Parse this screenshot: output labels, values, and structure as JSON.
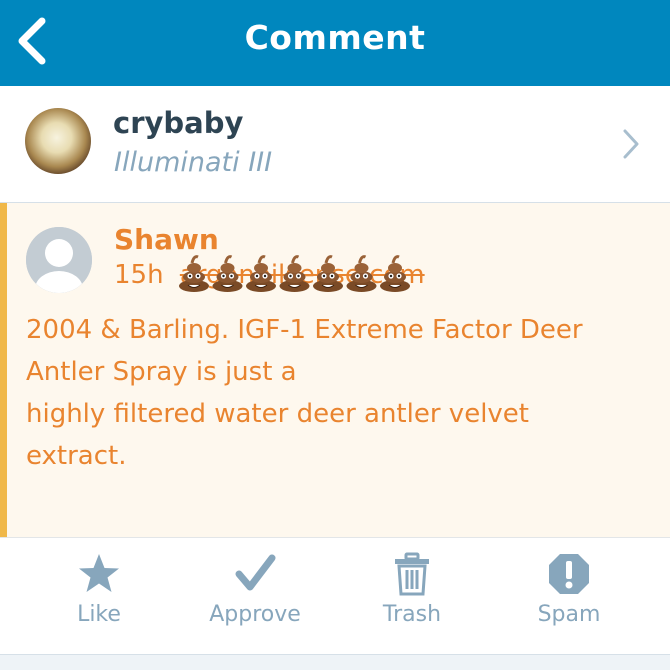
{
  "header": {
    "title": "Comment",
    "back_icon": "chevron-left-icon"
  },
  "post": {
    "site_name": "crybaby",
    "post_title": "Illuminati III",
    "chevron_icon": "chevron-right-icon"
  },
  "comment": {
    "author": "Shawn",
    "time": "15h",
    "url": "arganoilsense.com",
    "emoji_icon": "poop-emoji-icon",
    "emoji_count": 7,
    "text_lines": [
      "2004 & Barling. IGF-1 Extreme Factor Deer",
      "Antler Spray is just a",
      "highly filtered water deer antler velvet",
      "extract."
    ],
    "accent_color": "#f0b849",
    "text_color": "#e9842f",
    "background_color": "#fef8ee"
  },
  "actions": [
    {
      "label": "Like",
      "icon": "star-icon"
    },
    {
      "label": "Approve",
      "icon": "checkmark-icon"
    },
    {
      "label": "Trash",
      "icon": "trash-icon"
    },
    {
      "label": "Spam",
      "icon": "spam-icon"
    }
  ],
  "colors": {
    "brand": "#0087be",
    "action_gray": "#87a6bc"
  }
}
